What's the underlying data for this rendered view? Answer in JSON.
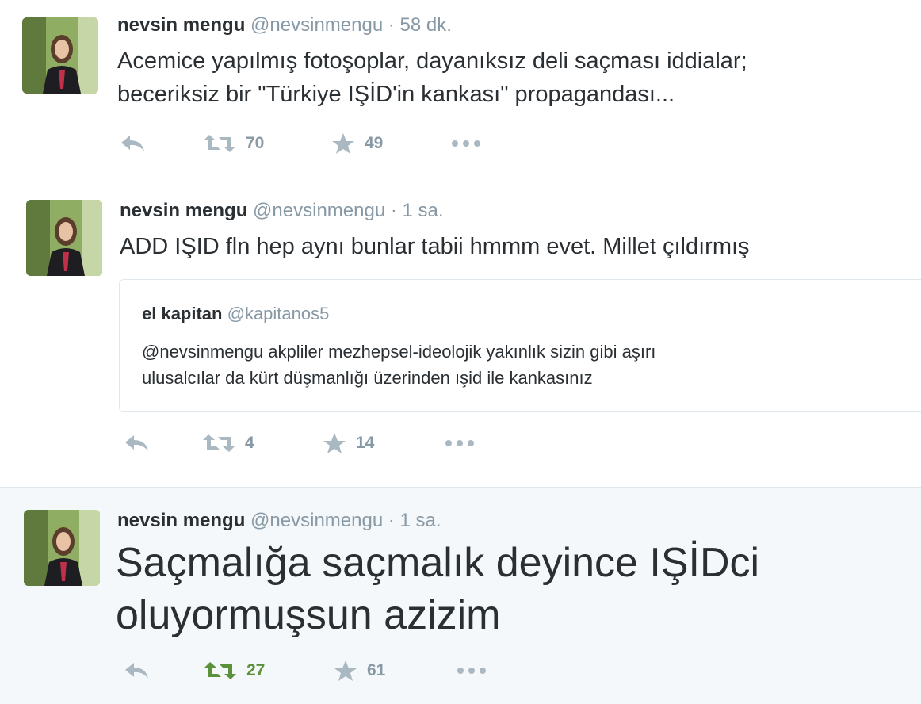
{
  "tweets": [
    {
      "name": "nevsin mengu",
      "handle": "@nevsinmengu",
      "separator": "·",
      "time": "58 dk.",
      "text_lines": [
        "Acemice yapılmış fotoşoplar, dayanıksız deli saçması iddialar;",
        "beceriksiz bir \"Türkiye IŞİD'in kankası\" propagandası..."
      ],
      "retweets": "70",
      "likes": "49"
    },
    {
      "name": "nevsin mengu",
      "handle": "@nevsinmengu",
      "separator": "·",
      "time": "1 sa.",
      "text_lines": [
        "ADD IŞID fln hep aynı bunlar tabii hmmm evet. Millet çıldırmış"
      ],
      "quote": {
        "name": "el kapitan",
        "handle": "@kapitanos5",
        "text_lines": [
          "@nevsinmengu akpliler mezhepsel-ideolojik yakınlık sizin gibi aşırı",
          "ulusalcılar da kürt düşmanlığı üzerinden ışid ile kankasınız"
        ]
      },
      "retweets": "4",
      "likes": "14"
    },
    {
      "name": "nevsin mengu",
      "handle": "@nevsinmengu",
      "separator": "·",
      "time": "1 sa.",
      "text_lines": [
        "Saçmalığa saçmalık deyince IŞİDci",
        "oluyormuşsun azizim"
      ],
      "retweets": "27",
      "likes": "61",
      "retweeted": true
    }
  ],
  "icons": {
    "reply": "reply-icon",
    "retweet": "retweet-icon",
    "like": "star-icon",
    "more": "more-icon"
  },
  "colors": {
    "retweet_active": "#5c913b",
    "icon_idle": "#aab8c2",
    "meta": "#8899a6"
  }
}
